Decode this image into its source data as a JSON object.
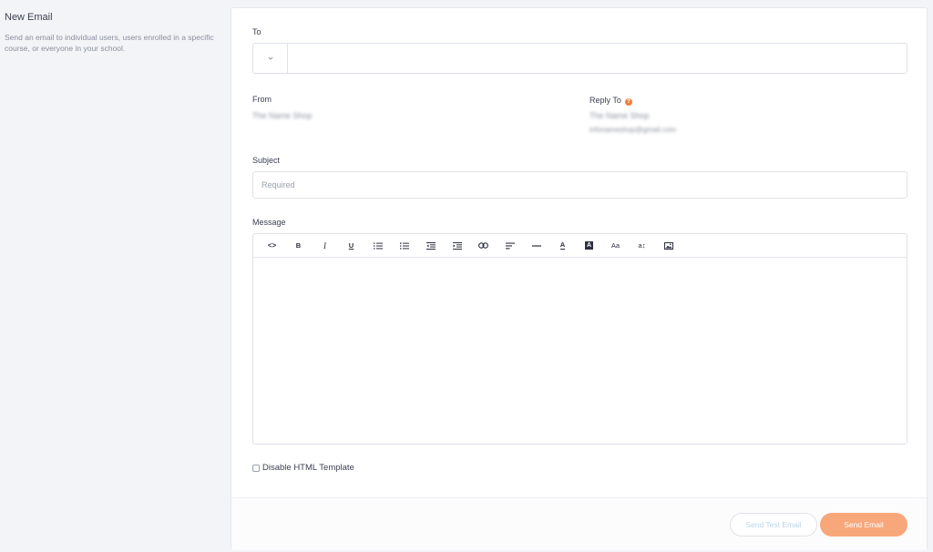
{
  "left": {
    "title": "New Email",
    "description": "Send an email to individual users, users enrolled in a specific course, or everyone in your school."
  },
  "form": {
    "to_label": "To",
    "to_dropdown_icon": "chevron-down-icon",
    "to_value": "",
    "from_label": "From",
    "from_name": "The Name Shop",
    "reply_to_label": "Reply To",
    "reply_to_help_icon": "question-icon",
    "reply_to_name": "The Name Shop",
    "reply_to_email": "infonameshop@gmail.com",
    "subject_label": "Subject",
    "subject_placeholder": "Required",
    "message_label": "Message",
    "disable_html_label": "Disable HTML Template",
    "disable_html_checked": false
  },
  "toolbar": {
    "code": "<>",
    "bold": "B",
    "italic": "I",
    "underline": "U",
    "font_color": "A",
    "bg_color": "A",
    "font_size": "Aa",
    "line_height": "a↕"
  },
  "actions": {
    "send_test": "Send Test Email",
    "send": "Send Email"
  },
  "colors": {
    "accent": "#f8a77a",
    "help": "#f1803a"
  }
}
